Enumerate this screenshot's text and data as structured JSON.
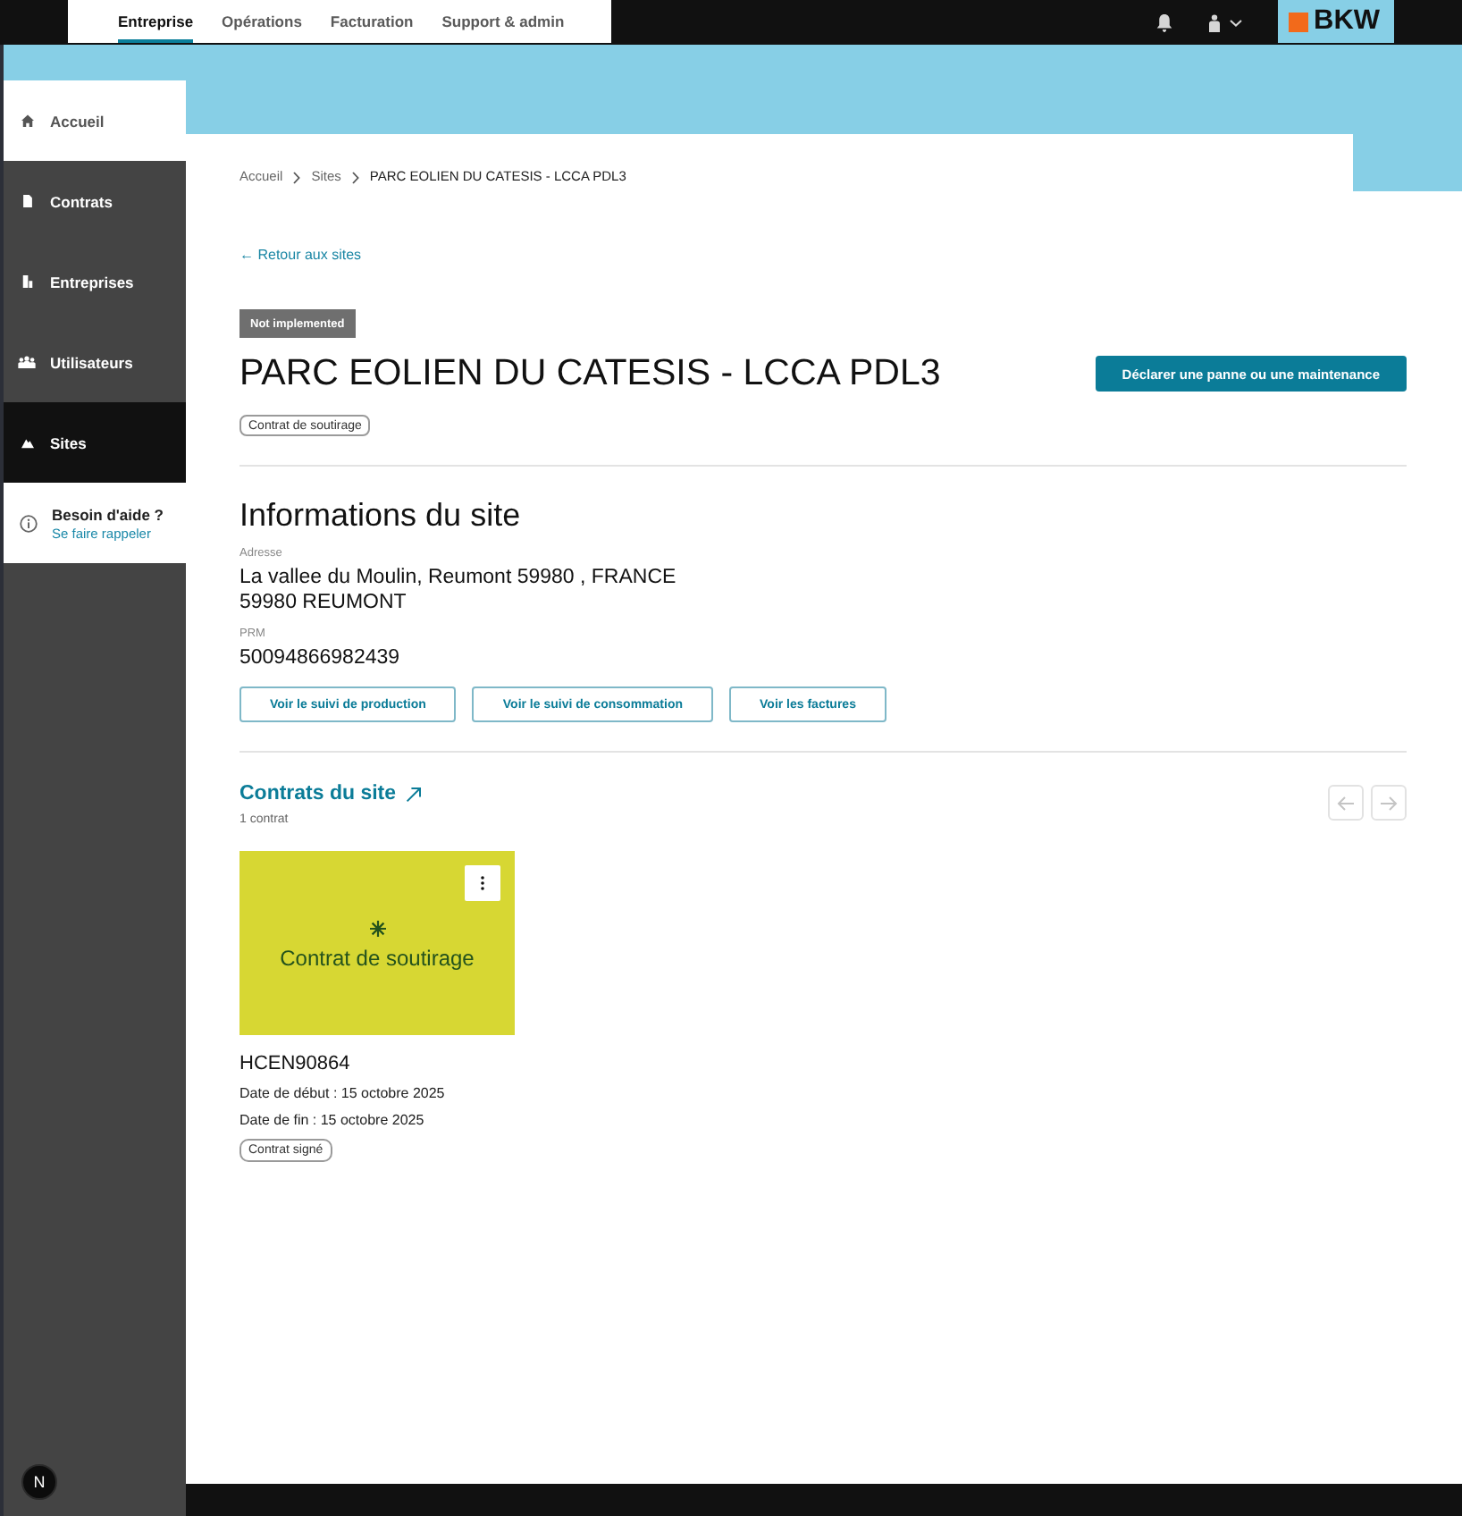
{
  "top_nav": {
    "tabs": [
      {
        "label": "Entreprise",
        "selected": true
      },
      {
        "label": "Opérations",
        "selected": false
      },
      {
        "label": "Facturation",
        "selected": false
      },
      {
        "label": "Support & admin",
        "selected": false
      }
    ],
    "brand": "BKW"
  },
  "sidebar": {
    "items": [
      {
        "label": "Accueil",
        "kind": "home",
        "selected": false
      },
      {
        "label": "Contrats",
        "kind": "document",
        "selected": false
      },
      {
        "label": "Entreprises",
        "kind": "building",
        "selected": false
      },
      {
        "label": "Utilisateurs",
        "kind": "users",
        "selected": false
      },
      {
        "label": "Sites",
        "kind": "sites",
        "selected": true
      }
    ],
    "help": {
      "title": "Besoin d'aide ?",
      "link": "Se faire rappeler"
    },
    "dev_badge": "N"
  },
  "breadcrumb": [
    "Accueil",
    "Sites",
    "PARC EOLIEN DU CATESIS - LCCA PDL3"
  ],
  "back_link": "← Retour aux sites",
  "status_badge": "Not implemented",
  "title": "PARC EOLIEN DU CATESIS - LCCA PDL3",
  "type_tag": "Contrat de soutirage",
  "primary_action": "Déclarer une panne ou une maintenance",
  "info": {
    "heading": "Informations du site",
    "fields": [
      {
        "label": "Adresse",
        "lines": [
          "La vallee du Moulin, Reumont 59980 , FRANCE",
          "59980 REUMONT"
        ]
      },
      {
        "label": "PRM",
        "lines": [
          "50094866982439"
        ]
      }
    ],
    "actions": [
      "Voir le suivi de production",
      "Voir le suivi de consommation",
      "Voir les factures"
    ]
  },
  "contracts": {
    "heading": "Contrats du site",
    "count": "1 contrat",
    "pager": [
      {
        "kind": "prev",
        "disabled": true
      },
      {
        "kind": "next",
        "disabled": true
      }
    ],
    "items": [
      {
        "type": "Contrat de soutirage",
        "color": "#d7d733",
        "reference": "HCEN90864",
        "start": "Date de début : 15 octobre 2025",
        "end": "Date de fin : 15 octobre 2025",
        "status": "Contrat signé"
      }
    ]
  }
}
